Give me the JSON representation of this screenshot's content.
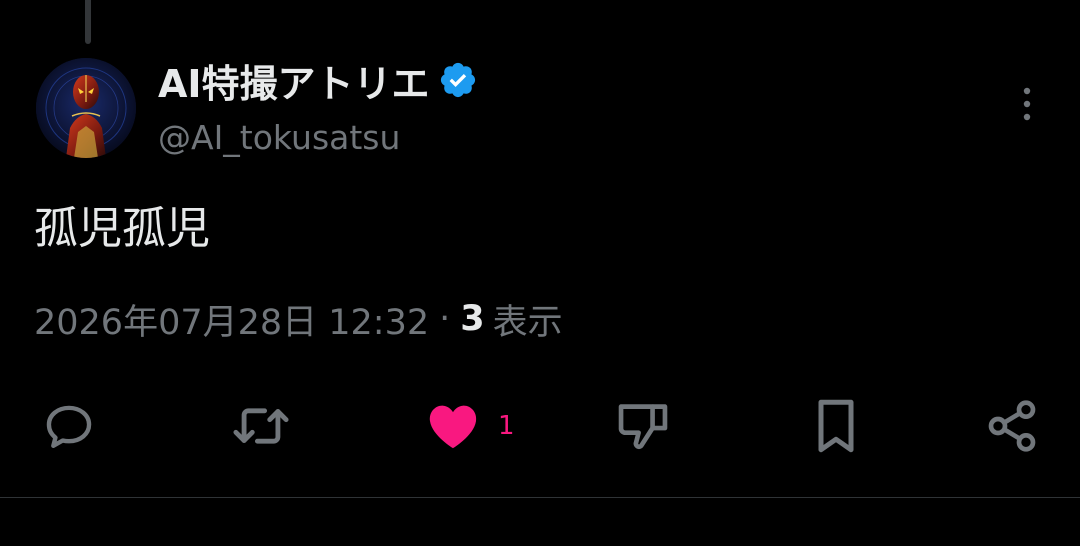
{
  "post": {
    "author": {
      "display_name": "AI特撮アトリエ",
      "handle": "@AI_tokusatsu",
      "verified": true,
      "verified_icon": "verified-badge-icon",
      "verified_color": "#1d9bf0"
    },
    "text": "孤児孤児",
    "timestamp": "2026年07月28日 12:32",
    "separator": "·",
    "views": {
      "count": "3",
      "label": "表示"
    },
    "actions": {
      "reply": {
        "icon": "reply-icon"
      },
      "repost": {
        "icon": "repost-icon"
      },
      "like": {
        "icon": "heart-icon",
        "count": "1",
        "liked": true,
        "color": "#f91880"
      },
      "downvote": {
        "icon": "thumbs-down-icon"
      },
      "bookmark": {
        "icon": "bookmark-icon"
      },
      "share": {
        "icon": "share-icon"
      }
    },
    "more_icon": "more-vertical-icon"
  },
  "theme": {
    "background": "#000000",
    "text_primary": "#e7e9ea",
    "text_secondary": "#71767b"
  }
}
